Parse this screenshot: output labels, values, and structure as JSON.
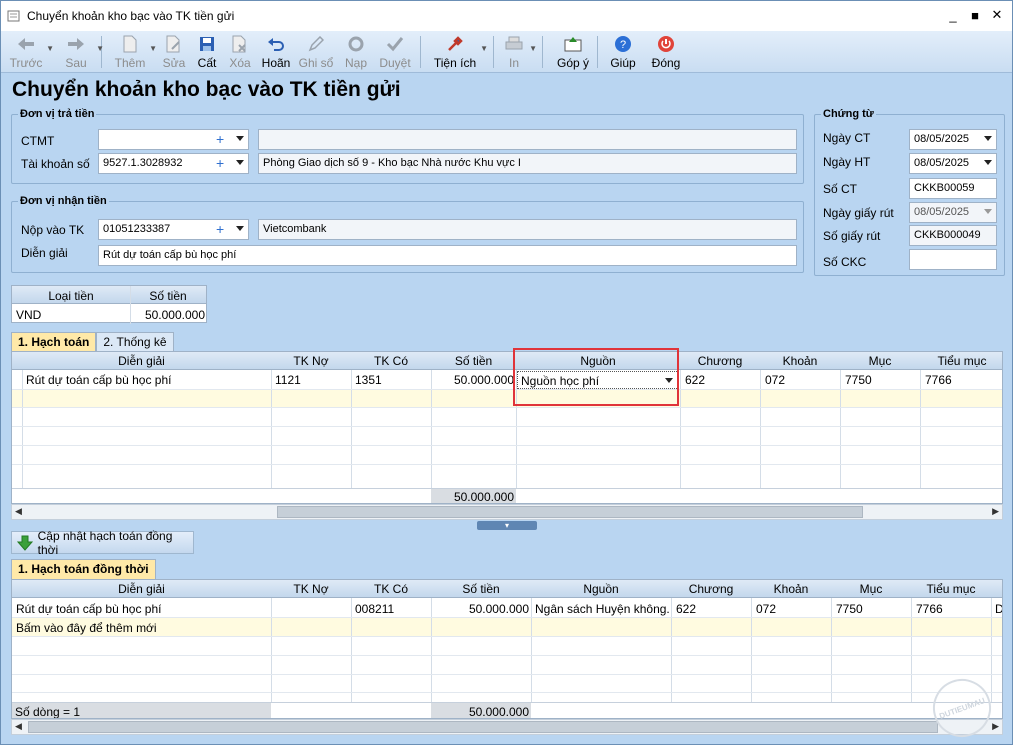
{
  "window": {
    "title": "Chuyển khoản kho bạc vào TK tiền gửi",
    "buttons": [
      "_",
      "■",
      "✕"
    ]
  },
  "toolbar": {
    "items": [
      {
        "label": "Trước",
        "icon": "arrow-left-icon",
        "enabled": false,
        "dropdown": true
      },
      {
        "label": "Sau",
        "icon": "arrow-right-icon",
        "enabled": false,
        "dropdown": true
      },
      {
        "label": "Thêm",
        "icon": "new-document-icon",
        "enabled": false,
        "dropdown": true
      },
      {
        "label": "Sửa",
        "icon": "edit-document-icon",
        "enabled": false
      },
      {
        "label": "Cất",
        "icon": "save-icon",
        "enabled": true
      },
      {
        "label": "Xóa",
        "icon": "delete-document-icon",
        "enabled": false
      },
      {
        "label": "Hoãn",
        "icon": "undo-icon",
        "enabled": true
      },
      {
        "label": "Ghi sổ",
        "icon": "pencil-icon",
        "enabled": false
      },
      {
        "label": "Nạp",
        "icon": "refresh-icon",
        "enabled": false
      },
      {
        "label": "Duyệt",
        "icon": "checkmark-icon",
        "enabled": false
      },
      {
        "label": "Tiện ích",
        "icon": "tools-icon",
        "enabled": true,
        "dropdown": true
      },
      {
        "label": "In",
        "icon": "printer-icon",
        "enabled": false,
        "dropdown": true
      },
      {
        "label": "Góp ý",
        "icon": "feedback-icon",
        "enabled": true
      },
      {
        "label": "Giúp",
        "icon": "help-icon",
        "enabled": true
      },
      {
        "label": "Đóng",
        "icon": "power-icon",
        "enabled": true
      }
    ]
  },
  "page": {
    "heading": "Chuyển khoản kho bạc vào TK tiền gửi"
  },
  "payer": {
    "legend": "Đơn vị trả tiền",
    "ctmt_label": "CTMT",
    "ctmt_value": "",
    "ctmt_desc": "",
    "account_label": "Tài khoản số",
    "account_value": "9527.1.3028932",
    "account_desc": "Phòng Giao dịch số 9 - Kho bạc Nhà nước Khu vực I"
  },
  "payee": {
    "legend": "Đơn vị nhận tiền",
    "account_label": "Nộp vào TK",
    "account_value": "01051233387",
    "bank": "Vietcombank",
    "desc_label": "Diễn giải",
    "desc_value": "Rút dự toán cấp bù học phí"
  },
  "voucher": {
    "legend": "Chứng từ",
    "fields": [
      {
        "label": "Ngày CT",
        "value": "08/05/2025"
      },
      {
        "label": "Ngày HT",
        "value": "08/05/2025"
      },
      {
        "label": "Số CT",
        "value": "CKKB00059"
      },
      {
        "label": "Ngày giấy rút",
        "value": "08/05/2025"
      },
      {
        "label": "Số giấy rút",
        "value": "CKKB000049"
      },
      {
        "label": "Số CKC",
        "value": ""
      }
    ]
  },
  "currency": {
    "headers": [
      "Loại tiền",
      "Số tiền"
    ],
    "currency": "VND",
    "amount": "50.000.000"
  },
  "tabs": [
    {
      "label": "1. Hạch toán"
    },
    {
      "label": "2. Thống kê"
    }
  ],
  "grid1": {
    "headers": [
      "Diễn giải",
      "TK Nợ",
      "TK Có",
      "Số tiền",
      "Nguồn",
      "Chương",
      "Khoản",
      "Mục",
      "Tiểu mục"
    ],
    "rows": [
      [
        "Rút dự toán cấp bù học phí",
        "1121",
        "1351",
        "50.000.000",
        "Nguồn học phí",
        "622",
        "072",
        "7750",
        "7766"
      ]
    ],
    "total": "50.000.000"
  },
  "update_button": "Cập nhật hạch toán đồng thời",
  "tab2": {
    "label": "1. Hạch toán đồng thời"
  },
  "grid2": {
    "headers": [
      "Diễn giải",
      "TK Nợ",
      "TK Có",
      "Số tiền",
      "Nguồn",
      "Chương",
      "Khoản",
      "Mục",
      "Tiểu mục"
    ],
    "rows": [
      [
        "Rút dự toán cấp bù học phí",
        "",
        "008211",
        "50.000.000",
        "Ngân sách Huyện không...",
        "622",
        "072",
        "7750",
        "7766"
      ]
    ],
    "overflow_cell": "D",
    "add_row": "Bấm vào đây để thêm mới",
    "row_count": "Số dòng = 1",
    "total": "50.000.000"
  },
  "watermark": "DUTIEUMAU"
}
